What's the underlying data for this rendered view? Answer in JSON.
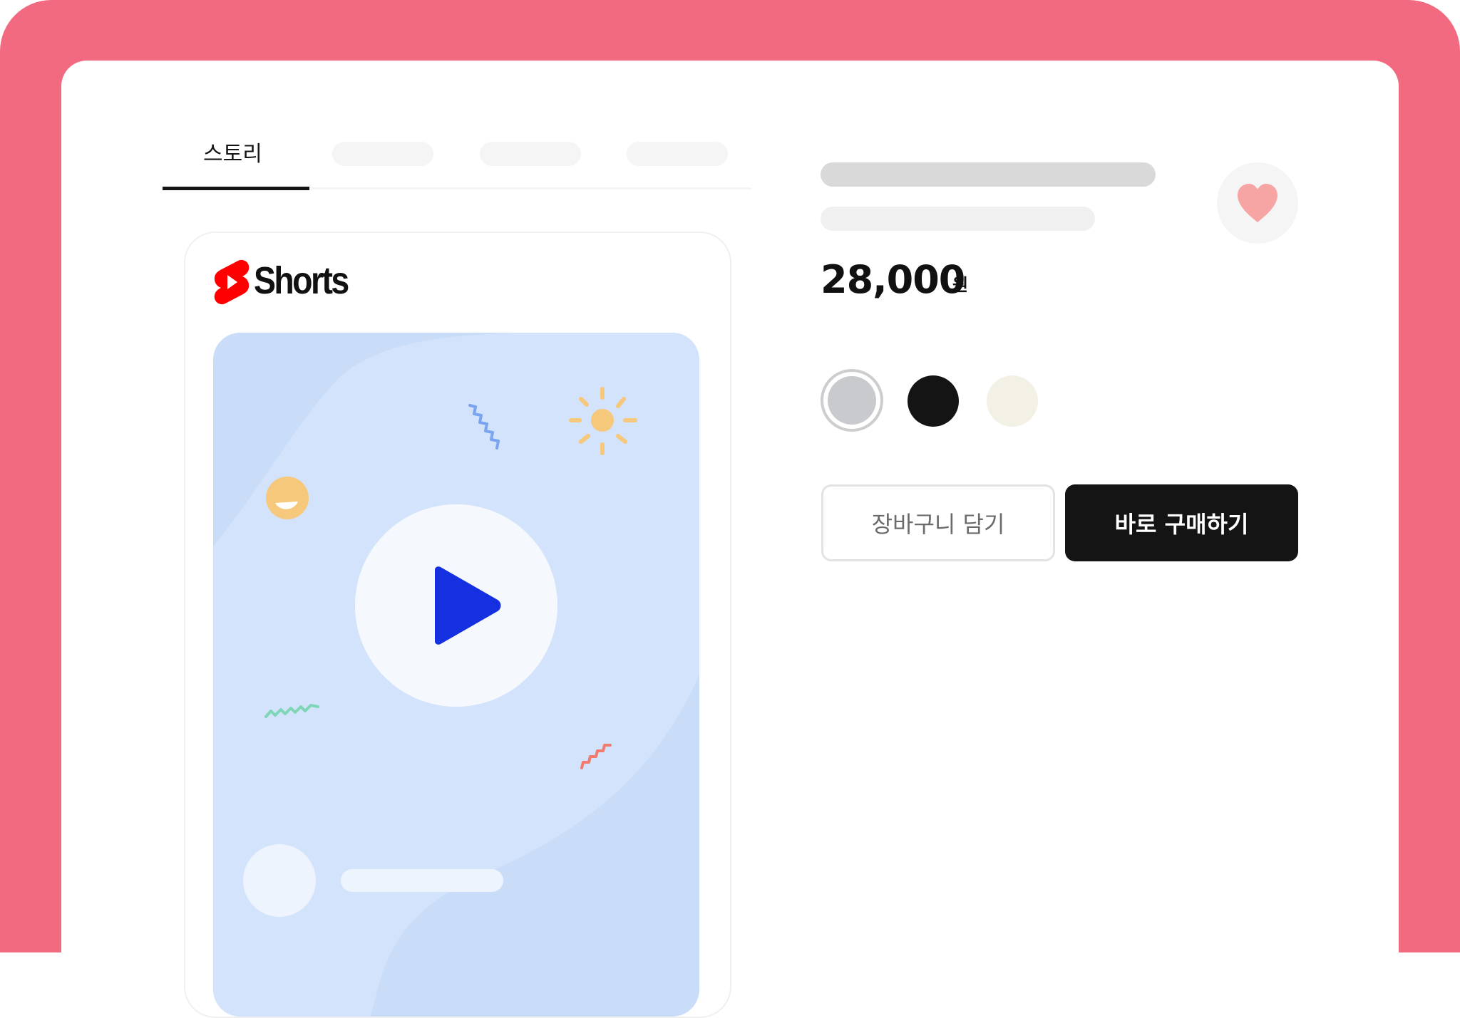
{
  "tabs": {
    "active_label": "스토리"
  },
  "video_card": {
    "brand_label": "Shorts",
    "brand_icon": "youtube-shorts-logo-icon",
    "play_icon": "play-icon"
  },
  "product": {
    "price": "28,000",
    "currency": "원",
    "wishlist_icon": "heart-icon",
    "color_options": [
      {
        "name": "gray",
        "color": "#c9cacd",
        "selected": true
      },
      {
        "name": "black",
        "color": "#141414",
        "selected": false
      },
      {
        "name": "cream",
        "color": "#f3f1e6",
        "selected": false
      }
    ],
    "add_to_cart_label": "장바구니 담기",
    "buy_now_label": "바로 구매하기"
  },
  "colors": {
    "frame_background": "#f26a80",
    "accent_play": "#1530e0",
    "heart": "#f7a4a4"
  }
}
